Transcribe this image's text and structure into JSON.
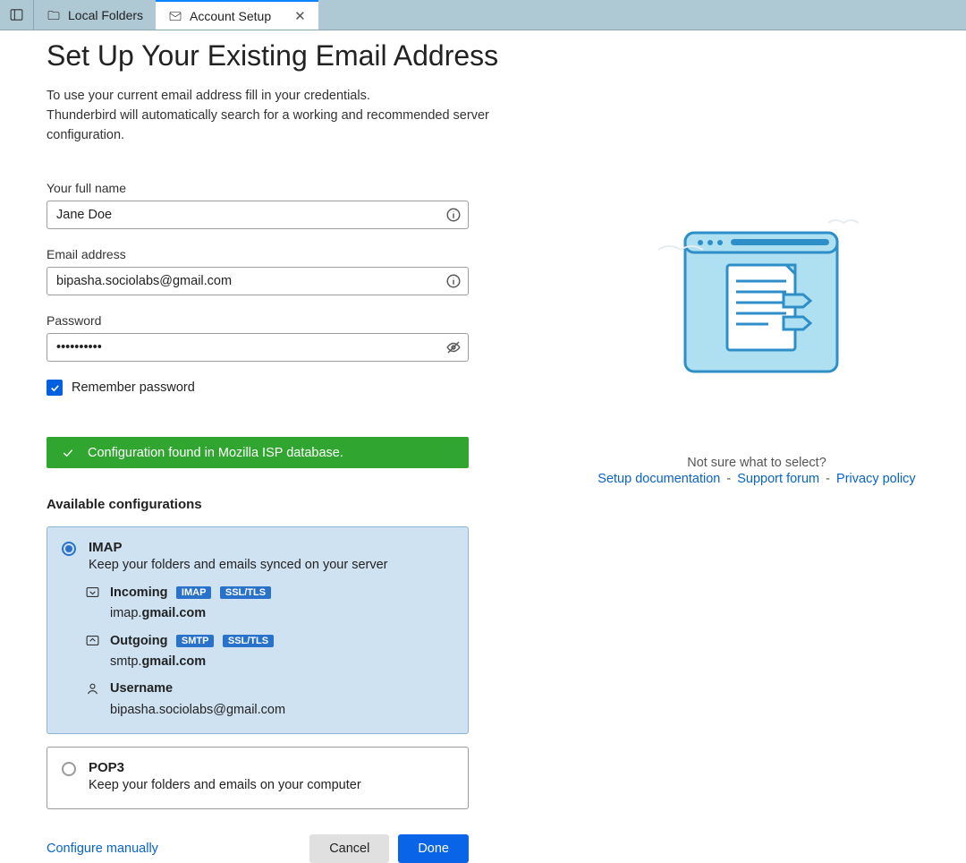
{
  "tabs": {
    "local_folders": "Local Folders",
    "account_setup": "Account Setup"
  },
  "header": {
    "title": "Set Up Your Existing Email Address",
    "line1": "To use your current email address fill in your credentials.",
    "line2": "Thunderbird will automatically search for a working and recommended server configuration."
  },
  "form": {
    "name_label": "Your full name",
    "name_value": "Jane Doe",
    "email_label": "Email address",
    "email_value": "bipasha.sociolabs@gmail.com",
    "password_label": "Password",
    "password_value": "••••••••••",
    "remember_label": "Remember password"
  },
  "status": {
    "text": "Configuration found in Mozilla ISP database."
  },
  "configs": {
    "title": "Available configurations",
    "imap": {
      "name": "IMAP",
      "desc": "Keep your folders and emails synced on your server",
      "incoming_label": "Incoming",
      "incoming_badge1": "IMAP",
      "incoming_badge2": "SSL/TLS",
      "incoming_prefix": "imap.",
      "incoming_domain": "gmail.com",
      "outgoing_label": "Outgoing",
      "outgoing_badge1": "SMTP",
      "outgoing_badge2": "SSL/TLS",
      "outgoing_prefix": "smtp.",
      "outgoing_domain": "gmail.com",
      "username_label": "Username",
      "username_value": "bipasha.sociolabs@gmail.com"
    },
    "pop3": {
      "name": "POP3",
      "desc": "Keep your folders and emails on your computer"
    }
  },
  "footer": {
    "configure": "Configure manually",
    "cancel": "Cancel",
    "done": "Done"
  },
  "help": {
    "prompt": "Not sure what to select?",
    "link1": "Setup documentation",
    "link2": "Support forum",
    "link3": "Privacy policy"
  }
}
